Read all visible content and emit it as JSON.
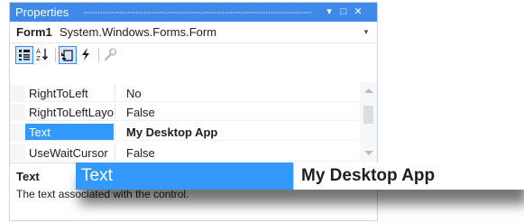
{
  "window": {
    "title": "Properties",
    "pin_glyph": "▾",
    "maximize_glyph": "□",
    "close_glyph": "✕"
  },
  "object_selector": {
    "name": "Form1",
    "type": "System.Windows.Forms.Form",
    "dropdown_glyph": "▼"
  },
  "toolbar": {
    "items": [
      {
        "icon": "categorized-icon",
        "active": true
      },
      {
        "icon": "alphabetical-icon",
        "active": false
      },
      {
        "icon": "properties-icon",
        "active": true
      },
      {
        "icon": "events-icon",
        "active": false
      },
      {
        "icon": "property-pages-icon",
        "active": false
      }
    ]
  },
  "properties": [
    {
      "name": "RightToLeft",
      "value": "No"
    },
    {
      "name": "RightToLeftLayout",
      "value": "False"
    },
    {
      "name": "Text",
      "value": "My Desktop App",
      "selected": true
    },
    {
      "name": "UseWaitCursor",
      "value": "False"
    }
  ],
  "description": {
    "title": "Text",
    "text": "The text associated with the control."
  },
  "zoom": {
    "name": "Text",
    "value": "My Desktop App"
  },
  "colors": {
    "titlebar": "#3f8ae8",
    "selection": "#3399ff",
    "active_tool_border": "#3f8ae8"
  }
}
